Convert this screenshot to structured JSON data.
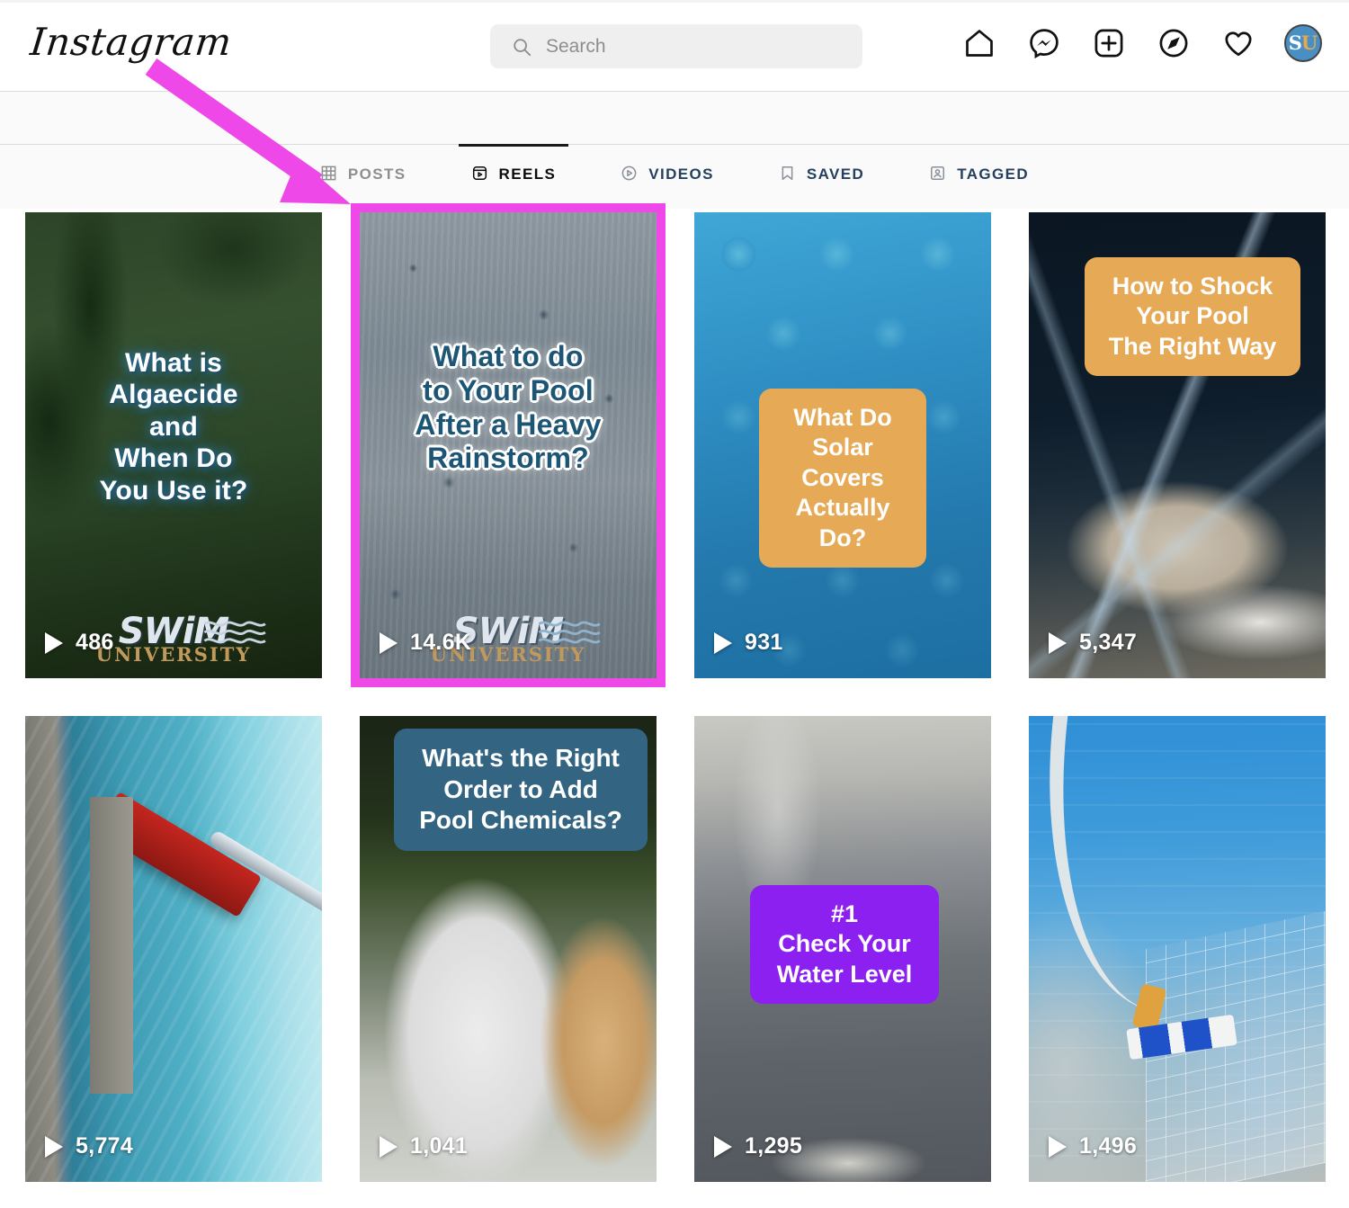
{
  "header": {
    "logo_text": "Instagram",
    "search": {
      "placeholder": "Search",
      "value": "",
      "icon": "search-icon"
    },
    "nav": [
      {
        "name": "home-icon",
        "label": "Home"
      },
      {
        "name": "messenger-icon",
        "label": "Messenger"
      },
      {
        "name": "new-post-icon",
        "label": "New post"
      },
      {
        "name": "explore-icon",
        "label": "Explore"
      },
      {
        "name": "activity-heart-icon",
        "label": "Notifications"
      }
    ],
    "avatar": {
      "name": "profile-avatar",
      "initials_first": "S",
      "initials_second": "U",
      "bg_color": "#4a8fc4"
    }
  },
  "tabs": [
    {
      "label": "POSTS",
      "icon": "grid-icon",
      "state": "inactive",
      "color": "#8e8e8e"
    },
    {
      "label": "REELS",
      "icon": "reels-icon",
      "state": "active",
      "color": "#0b0b0b"
    },
    {
      "label": "VIDEOS",
      "icon": "video-play-icon",
      "state": "blue",
      "color": "#24405e"
    },
    {
      "label": "SAVED",
      "icon": "bookmark-icon",
      "state": "blue",
      "color": "#24405e"
    },
    {
      "label": "TAGGED",
      "icon": "tagged-person-icon",
      "state": "blue",
      "color": "#24405e"
    }
  ],
  "annotation": {
    "type": "arrow",
    "color": "#ee49e8",
    "points_to": "reels-tab-and-second-reel"
  },
  "grid": {
    "highlight_color": "#ee49e8",
    "reels": [
      {
        "id": "reel-1",
        "views": "486",
        "overlay_text": "What is\nAlgaecide\nand\nWhen Do\nYou Use it?",
        "overlay_style": "glow-white",
        "watermark": {
          "line1": "SWiM",
          "line2": "UNIVERSITY"
        },
        "highlighted": false
      },
      {
        "id": "reel-2",
        "views": "14.6K",
        "overlay_text": "What to do\nto Your Pool\nAfter a Heavy\nRainstorm?",
        "overlay_style": "outline-teal",
        "watermark": {
          "line1": "SWiM",
          "line2": "UNIVERSITY"
        },
        "highlighted": true
      },
      {
        "id": "reel-3",
        "views": "931",
        "overlay_text": "What Do\nSolar Covers\nActually Do?",
        "overlay_style": "box-orange",
        "highlighted": false
      },
      {
        "id": "reel-4",
        "views": "5,347",
        "overlay_text": "How to Shock\nYour Pool\nThe Right Way",
        "overlay_style": "box-orange",
        "highlighted": false
      },
      {
        "id": "reel-5",
        "views": "5,774",
        "overlay_text": "",
        "overlay_style": "none",
        "highlighted": false
      },
      {
        "id": "reel-6",
        "views": "1,041",
        "overlay_text": "What's the Right\nOrder to Add\nPool Chemicals?",
        "overlay_style": "box-teal",
        "highlighted": false
      },
      {
        "id": "reel-7",
        "views": "1,295",
        "overlay_text": "#1\nCheck Your\nWater Level",
        "overlay_style": "box-purple",
        "highlighted": false
      },
      {
        "id": "reel-8",
        "views": "1,496",
        "overlay_text": "",
        "overlay_style": "none",
        "highlighted": false
      }
    ]
  }
}
